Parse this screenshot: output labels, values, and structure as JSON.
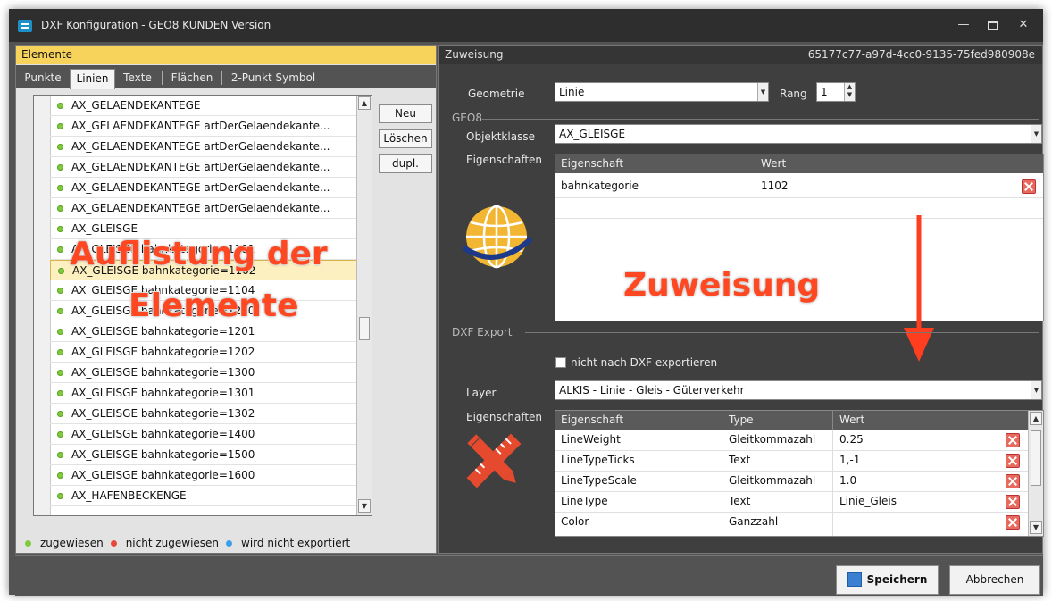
{
  "window": {
    "title": "DXF Konfiguration -   GEO8 KUNDEN Version",
    "controls": [
      "minimize-icon",
      "maximize-icon",
      "close-icon"
    ]
  },
  "left": {
    "header": "Elemente",
    "tabs": [
      {
        "label": "Punkte"
      },
      {
        "label": "Linien",
        "active": true
      },
      {
        "label": "Texte"
      },
      {
        "label": "Flächen"
      },
      {
        "label": "2-Punkt Symbol"
      }
    ],
    "items": [
      {
        "label": "AX_GELAENDEKANTEGE"
      },
      {
        "label": "AX_GELAENDEKANTEGE artDerGelaendekante..."
      },
      {
        "label": "AX_GELAENDEKANTEGE artDerGelaendekante..."
      },
      {
        "label": "AX_GELAENDEKANTEGE artDerGelaendekante..."
      },
      {
        "label": "AX_GELAENDEKANTEGE artDerGelaendekante..."
      },
      {
        "label": "AX_GELAENDEKANTEGE artDerGelaendekante..."
      },
      {
        "label": "AX_GLEISGE"
      },
      {
        "label": "AX_GLEISGE bahnkategorie=1101"
      },
      {
        "label": "AX_GLEISGE bahnkategorie=1102",
        "selected": true
      },
      {
        "label": "AX_GLEISGE bahnkategorie=1104"
      },
      {
        "label": "AX_GLEISGE bahnkategorie=1200"
      },
      {
        "label": "AX_GLEISGE bahnkategorie=1201"
      },
      {
        "label": "AX_GLEISGE bahnkategorie=1202"
      },
      {
        "label": "AX_GLEISGE bahnkategorie=1300"
      },
      {
        "label": "AX_GLEISGE bahnkategorie=1301"
      },
      {
        "label": "AX_GLEISGE bahnkategorie=1302"
      },
      {
        "label": "AX_GLEISGE bahnkategorie=1400"
      },
      {
        "label": "AX_GLEISGE bahnkategorie=1500"
      },
      {
        "label": "AX_GLEISGE bahnkategorie=1600"
      },
      {
        "label": "AX_HAFENBECKENGE"
      }
    ],
    "buttons": {
      "new": "Neu",
      "delete": "Löschen",
      "duplicate": "dupl."
    },
    "legend": {
      "assigned": "zugewiesen",
      "unassigned": "nicht zugewiesen",
      "not_exported": "wird nicht exportiert"
    },
    "overlay": {
      "line1": "Auflistung der",
      "line2": "Elemente"
    }
  },
  "right": {
    "header": "Zuweisung",
    "guid": "65177c77-a97d-4cc0-9135-75fed980908e",
    "geometry_label": "Geometrie",
    "geometry_value": "Linie",
    "rank_label": "Rang",
    "rank_value": "1",
    "geo8_group": "GEO8",
    "objclass_label": "Objektklasse",
    "objclass_value": "AX_GLEISGE",
    "props_label": "Eigenschaften",
    "geo8_grid": {
      "headers": [
        "Eigenschaft",
        "Wert"
      ],
      "rows": [
        {
          "name": "bahnkategorie",
          "value": "1102"
        }
      ]
    },
    "overlay": "Zuweisung",
    "dxf_group": "DXF Export",
    "no_export_label": "nicht nach DXF exportieren",
    "layer_label": "Layer",
    "layer_value": "ALKIS - Linie - Gleis - Güterverkehr",
    "dxf_props_label": "Eigenschaften",
    "dxf_grid": {
      "headers": [
        "Eigenschaft",
        "Type",
        "Wert"
      ],
      "rows": [
        {
          "name": "LineWeight",
          "type": "Gleitkommazahl",
          "value": "0.25"
        },
        {
          "name": "LineTypeTicks",
          "type": "Text",
          "value": "1,-1"
        },
        {
          "name": "LineTypeScale",
          "type": "Gleitkommazahl",
          "value": "1.0"
        },
        {
          "name": "LineType",
          "type": "Text",
          "value": "Linie_Gleis"
        },
        {
          "name": "Color",
          "type": "Ganzzahl",
          "value": ""
        }
      ]
    }
  },
  "footer": {
    "save": "Speichern",
    "cancel": "Abbrechen"
  },
  "colors": {
    "header_yellow": "#f7d35c",
    "overlay_red": "#ff4822",
    "dot_green": "#7fca3d",
    "dot_red": "#e8493a",
    "dot_blue": "#3aa0e8"
  }
}
